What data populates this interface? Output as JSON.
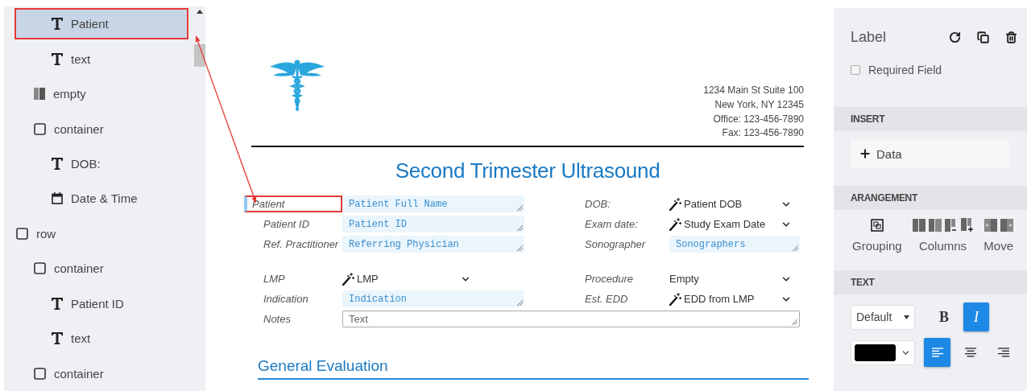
{
  "tree": [
    {
      "children": [
        {
          "children": [
            {
              "label": "Patient",
              "kind": "text",
              "selected": true
            },
            {
              "label": "text",
              "kind": "text",
              "selected": false
            }
          ]
        },
        {
          "label": "empty",
          "kind": "columns",
          "selected": false
        },
        {
          "label": "container",
          "kind": "container",
          "selected": false,
          "children": [
            {
              "label": "DOB:",
              "kind": "text",
              "selected": false
            },
            {
              "label": "Date & Time",
              "kind": "datetime",
              "selected": false
            }
          ]
        }
      ]
    },
    {
      "label": "row",
      "kind": "container",
      "selected": false,
      "children": [
        {
          "label": "container",
          "kind": "container",
          "selected": false,
          "children": [
            {
              "label": "Patient ID",
              "kind": "text",
              "selected": false
            },
            {
              "label": "text",
              "kind": "text",
              "selected": false
            }
          ]
        },
        {
          "label": "container",
          "kind": "container",
          "selected": false
        }
      ]
    }
  ],
  "document": {
    "address": [
      "1234 Main St Suite 100",
      "New York, NY 12345",
      "Office: 123-456-7890",
      "Fax: 123-456-7890"
    ],
    "title": "Second Trimester Ultrasound",
    "form_groups": [
      {
        "rows": [
          {
            "left": {
              "label": "Patient",
              "selected": true,
              "kind": "textarea",
              "value": "Patient Full Name"
            },
            "right": {
              "label": "DOB:",
              "selected": false,
              "kind": "wand-select",
              "value": "Patient DOB"
            }
          },
          {
            "left": {
              "label": "Patient ID",
              "selected": false,
              "kind": "textarea",
              "value": "Patient ID"
            },
            "right": {
              "label": "Exam date:",
              "selected": false,
              "kind": "wand-select",
              "value": "Study Exam Date"
            }
          },
          {
            "left": {
              "label": "Ref. Practitioner",
              "selected": false,
              "kind": "textarea",
              "value": "Referring Physician"
            },
            "right": {
              "label": "Sonographer",
              "selected": false,
              "kind": "textarea",
              "value": "Sonographers"
            }
          }
        ]
      },
      {
        "rows": [
          {
            "left": {
              "label": "LMP",
              "selected": false,
              "kind": "wand-select",
              "value": "LMP"
            },
            "right": {
              "label": "Procedure",
              "selected": false,
              "kind": "select",
              "value": "Empty"
            }
          },
          {
            "left": {
              "label": "Indication",
              "selected": false,
              "kind": "textarea",
              "value": "Indication"
            },
            "right": {
              "label": "Est. EDD",
              "selected": false,
              "kind": "wand-select",
              "value": "EDD from LMP"
            }
          },
          {
            "left": {
              "label": "Notes",
              "selected": false,
              "kind": "textbox",
              "placeholder": "Text"
            }
          }
        ]
      }
    ],
    "section_heading": "General Evaluation"
  },
  "properties": {
    "title": "Label",
    "required_field": {
      "label": "Required Field",
      "checked": false
    },
    "sections": [
      {
        "heading": "INSERT",
        "kind": "insert",
        "button": "Data"
      },
      {
        "heading": "ARANGEMENT",
        "kind": "arrangement",
        "groups": [
          "Grouping",
          "Columns",
          "Move"
        ]
      },
      {
        "heading": "TEXT",
        "kind": "text",
        "font": "Default",
        "styles": [
          {
            "kind": "bold",
            "label": "B",
            "selected": false
          },
          {
            "kind": "italic",
            "label": "I",
            "selected": true
          }
        ],
        "color": "#000000",
        "aligns": [
          {
            "kind": "left",
            "selected": true
          },
          {
            "kind": "center",
            "selected": false
          },
          {
            "kind": "right",
            "selected": false
          }
        ]
      }
    ]
  }
}
